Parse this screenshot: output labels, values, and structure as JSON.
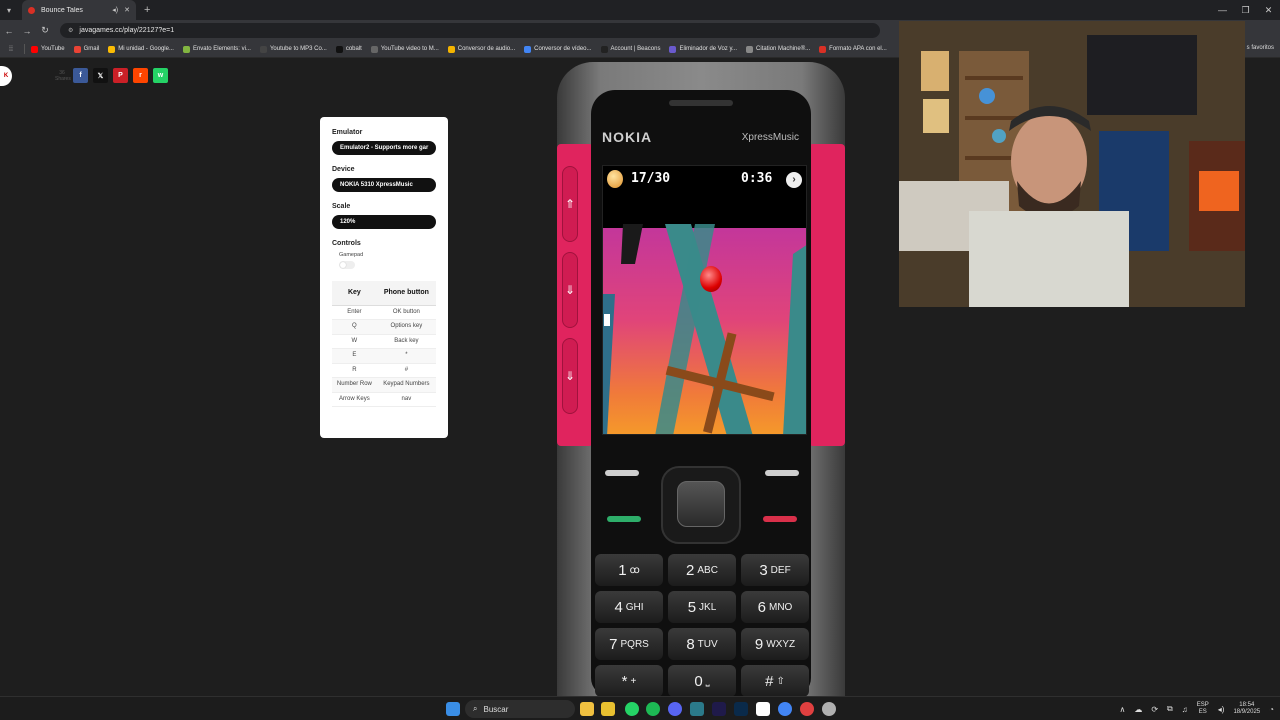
{
  "browser": {
    "tab_title": "Bounce Tales",
    "url": "javagames.cc/play/22127?e=1",
    "bookmarks": [
      {
        "label": "YouTube",
        "color": "#ff0000"
      },
      {
        "label": "Gmail",
        "color": "#ea4335"
      },
      {
        "label": "Mi unidad - Google...",
        "color": "#fbbc04"
      },
      {
        "label": "Envato Elements: vi...",
        "color": "#82b541"
      },
      {
        "label": "Youtube to MP3 Co...",
        "color": "#444444"
      },
      {
        "label": "cobalt",
        "color": "#111111"
      },
      {
        "label": "YouTube video to M...",
        "color": "#666666"
      },
      {
        "label": "Conversor de audio...",
        "color": "#f4b400"
      },
      {
        "label": "Conversor de vídeo...",
        "color": "#4285f4"
      },
      {
        "label": "Account | Beacons",
        "color": "#222222"
      },
      {
        "label": "Eliminador de Voz y...",
        "color": "#6a5acd"
      },
      {
        "label": "Citation Machine®...",
        "color": "#888888"
      },
      {
        "label": "Formato APA con el...",
        "color": "#d93025"
      }
    ],
    "all_bookmarks": "s favoritos"
  },
  "share": {
    "count": "36 Shares",
    "buttons": [
      {
        "icon": "facebook-icon",
        "glyph": "f",
        "color": "#3b5998"
      },
      {
        "icon": "x-icon",
        "glyph": "𝕏",
        "color": "#111111"
      },
      {
        "icon": "pinterest-icon",
        "glyph": "P",
        "color": "#cb2027"
      },
      {
        "icon": "reddit-icon",
        "glyph": "r",
        "color": "#ff4500"
      },
      {
        "icon": "whatsapp-icon",
        "glyph": "w",
        "color": "#25d366"
      }
    ]
  },
  "panel": {
    "emulator_label": "Emulator",
    "emulator_value": "Emulator2 - Supports more gar",
    "device_label": "Device",
    "device_value": "NOKIA 5310 XpressMusic",
    "scale_label": "Scale",
    "scale_value": "120%",
    "controls_label": "Controls",
    "gamepad_label": "Gamepad",
    "table": {
      "headers": [
        "Key",
        "Phone button"
      ],
      "rows": [
        [
          "Enter",
          "OK button"
        ],
        [
          "Q",
          "Options key"
        ],
        [
          "W",
          "Back key"
        ],
        [
          "E",
          "*"
        ],
        [
          "R",
          "#"
        ],
        [
          "Number Row",
          "Keypad Numbers"
        ],
        [
          "Arrow Keys",
          "nav"
        ]
      ]
    }
  },
  "phone": {
    "brand": "NOKIA",
    "sub_brand": "XpressMusic",
    "game": {
      "eggs": "17/30",
      "timer": "0:36"
    },
    "keys": [
      {
        "n": "1",
        "l": "ꝏ"
      },
      {
        "n": "2",
        "l": "ABC"
      },
      {
        "n": "3",
        "l": "DEF"
      },
      {
        "n": "4",
        "l": "GHI"
      },
      {
        "n": "5",
        "l": "JKL"
      },
      {
        "n": "6",
        "l": "MNO"
      },
      {
        "n": "7",
        "l": "PQRS"
      },
      {
        "n": "8",
        "l": "TUV"
      },
      {
        "n": "9",
        "l": "WXYZ"
      },
      {
        "n": "*",
        "l": "+"
      },
      {
        "n": "0",
        "l": "⎵"
      },
      {
        "n": "#",
        "l": "⇧"
      }
    ]
  },
  "taskbar": {
    "search_label": "Buscar",
    "lang": "ESP",
    "lang_sub": "ES",
    "time": "18:54",
    "date": "18/9/2025"
  }
}
